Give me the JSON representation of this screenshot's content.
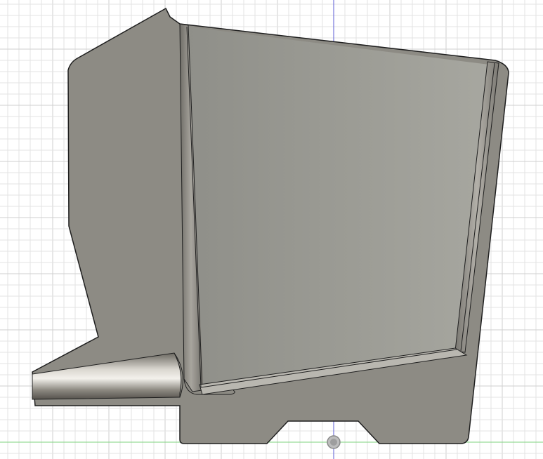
{
  "viewport": {
    "background": "#ffffff",
    "grid_minor_color": "#e3e3e3",
    "grid_major_color": "#cfcfcf",
    "axis_vertical_color": "#5b5bd6",
    "axis_horizontal_color": "#7fd37f",
    "origin_marker": "origin-icon"
  },
  "model": {
    "body_color": "#8d8b84",
    "face_color": "#9a9a93",
    "edge_color": "#1f1f1f",
    "cone_color": "#a19d95"
  }
}
